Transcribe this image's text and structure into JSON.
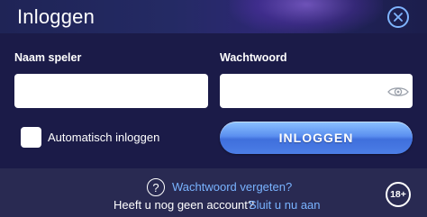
{
  "header": {
    "title": "Inloggen",
    "close_icon": "close-icon",
    "accent_color": "#7fb4ff"
  },
  "form": {
    "username": {
      "label": "Naam speler",
      "value": "",
      "placeholder": ""
    },
    "password": {
      "label": "Wachtwoord",
      "value": "",
      "placeholder": "",
      "toggle_icon": "eye-icon"
    },
    "remember": {
      "label": "Automatisch inloggen",
      "checked": false
    },
    "login_button": "INLOGGEN"
  },
  "footer": {
    "help_icon": "question-icon",
    "help_glyph": "?",
    "forgot_password": "Wachtwoord vergeten?",
    "no_account_text": "Heeft u nog geen account?",
    "signup_link": "Sluit u nu aan",
    "age_badge": "18+",
    "link_color": "#79b3ff"
  }
}
